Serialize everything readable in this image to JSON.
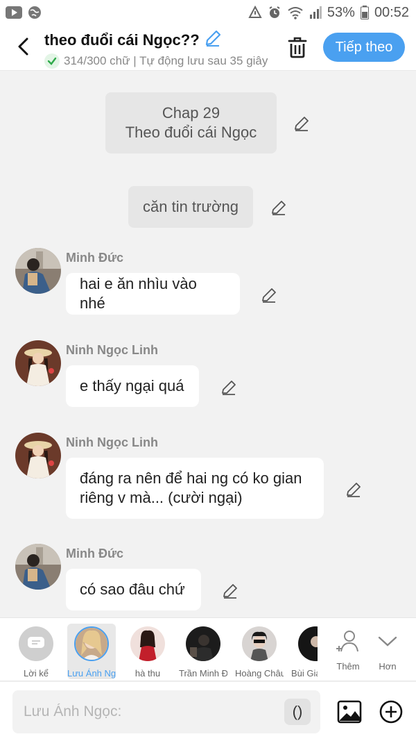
{
  "status_bar": {
    "battery_percent": "53%",
    "time": "00:52",
    "icons": [
      "youtube-icon",
      "globe-icon",
      "data-saver-icon",
      "alarm-icon",
      "wifi-icon",
      "signal-icon",
      "battery-icon"
    ]
  },
  "header": {
    "title": "theo đuổi cái Ngọc??",
    "subtitle": "314/300 chữ | Tự động lưu sau 35 giây",
    "next_label": "Tiếp theo",
    "accent_color": "#4aa0f0"
  },
  "chat": {
    "chapter_title_line1": "Chap 29",
    "chapter_title_line2": "Theo đuổi cái Ngọc",
    "scene_text": "căn tin trường",
    "messages": [
      {
        "sender": "Minh Đức",
        "text": "hai e ăn nhìu vào nhé"
      },
      {
        "sender": "Ninh Ngọc Linh",
        "text": "e thấy ngại quá"
      },
      {
        "sender": "Ninh Ngọc Linh",
        "text_line1": "đáng ra nên để hai ng có ko gian",
        "text_line2": "riêng v mà... (cười ngại)"
      },
      {
        "sender": "Minh Đức",
        "text": "có sao đâu chứ"
      }
    ]
  },
  "character_bar": {
    "items": [
      {
        "label": "Lời kể"
      },
      {
        "label": "Lưu Ánh Ngọc",
        "selected": true
      },
      {
        "label": "hà thu"
      },
      {
        "label": "Trần Minh Đức"
      },
      {
        "label": "Hoàng Châu"
      },
      {
        "label": "Bùi Gia"
      }
    ],
    "add_label": "Thêm",
    "more_label": "Hơn"
  },
  "input": {
    "placeholder": "Lưu Ánh Ngọc:",
    "paren_label": "()"
  }
}
